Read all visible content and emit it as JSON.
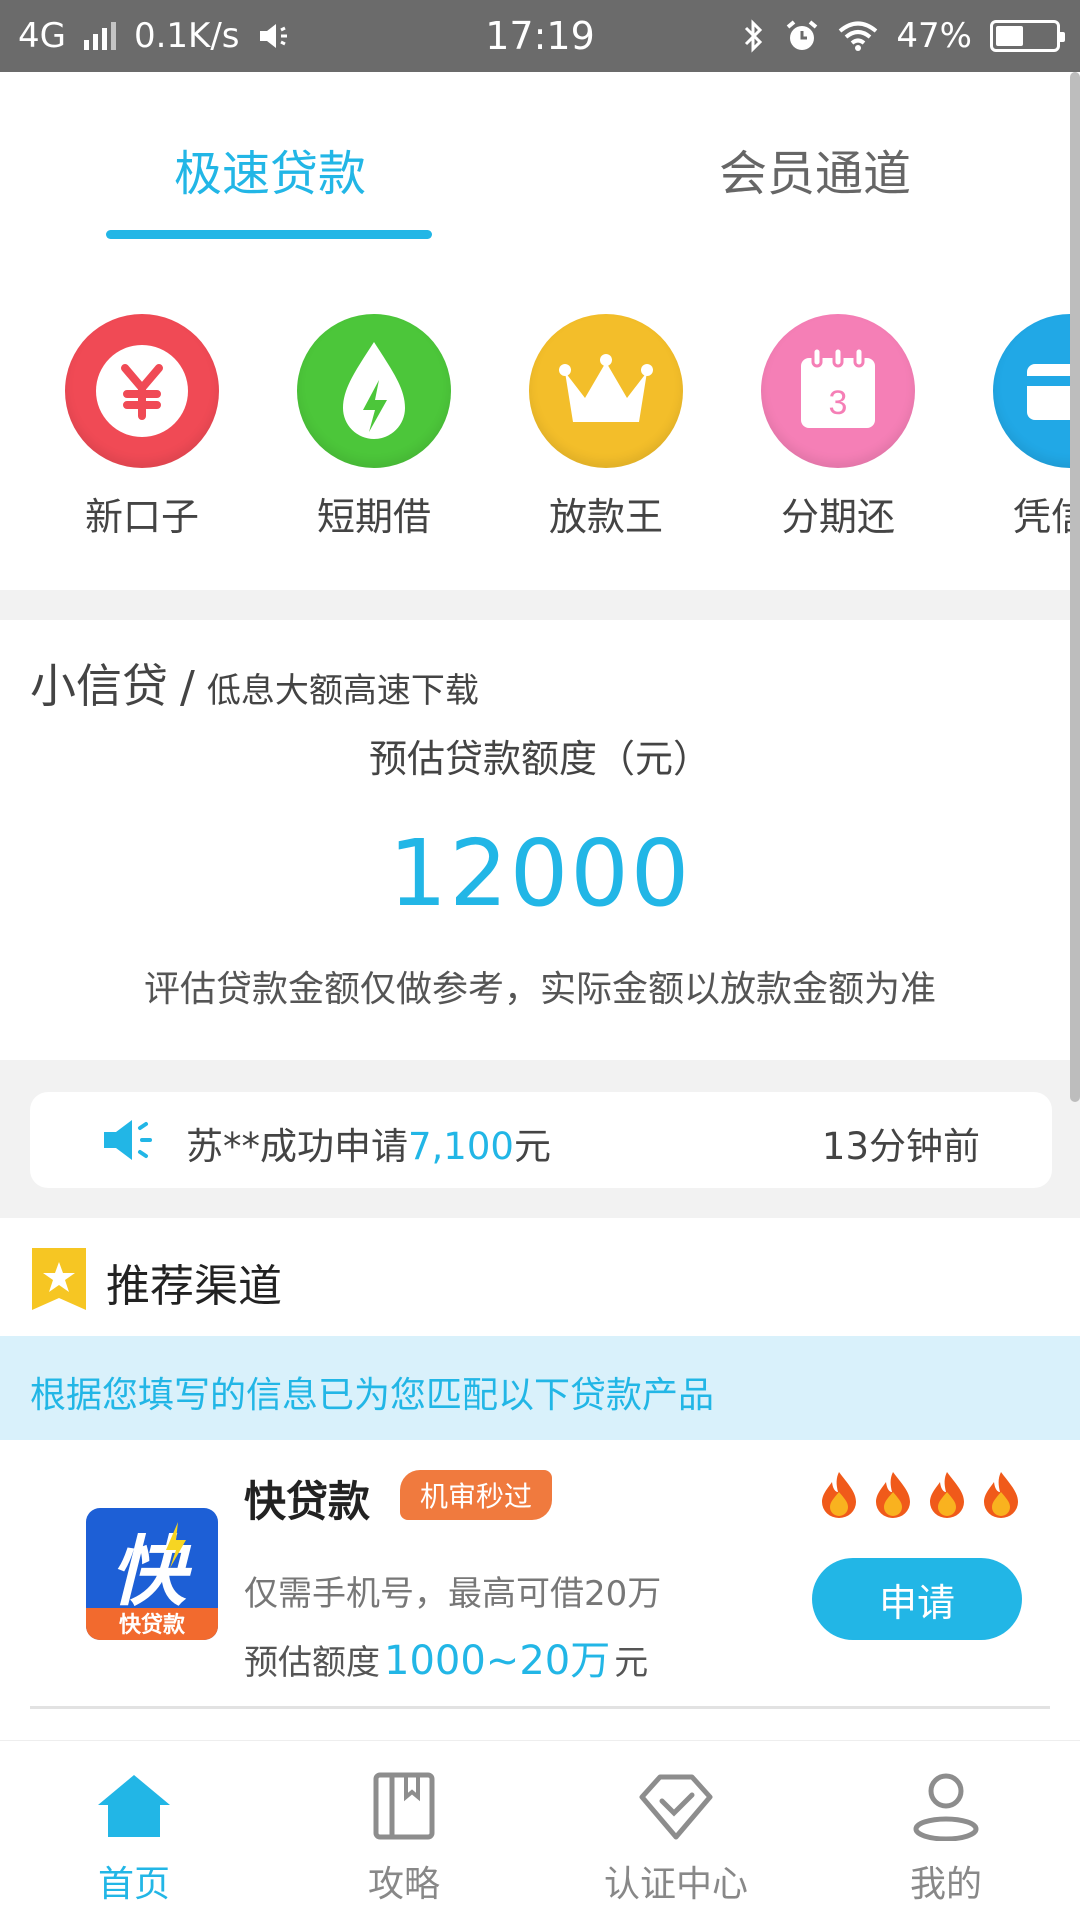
{
  "status_bar": {
    "network": "4G",
    "speed": "0.1K/s",
    "time": "17:19",
    "battery": "47%",
    "battery_level": 0.47
  },
  "tabs": [
    {
      "label": "极速贷款",
      "active": true
    },
    {
      "label": "会员通道",
      "active": false
    }
  ],
  "categories": [
    {
      "label": "新口子",
      "icon": "yuan-coin-icon",
      "color": "#f04a55"
    },
    {
      "label": "短期借",
      "icon": "lightning-drop-icon",
      "color": "#4cc63a"
    },
    {
      "label": "放款王",
      "icon": "crown-icon",
      "color": "#f3be2a"
    },
    {
      "label": "分期还",
      "icon": "calendar-icon",
      "color": "#f57fb6",
      "calendar_day": "3"
    },
    {
      "label": "凭信用",
      "icon": "card-icon",
      "color": "#21a8e6"
    }
  ],
  "estimate": {
    "brand": "小信贷",
    "slash": "/",
    "tagline": "低息大额高速下载",
    "amount_label": "预估贷款额度（元）",
    "amount": "12000",
    "note": "评估贷款金额仅做参考，实际金额以放款金额为准"
  },
  "notice": {
    "prefix": "苏**成功申请",
    "amount": "7,100",
    "suffix": "元",
    "time": "13分钟前"
  },
  "recommend": {
    "title": "推荐渠道",
    "match_text": "根据您填写的信息已为您匹配以下贷款产品"
  },
  "product": {
    "name": "快贷款",
    "badge": "机审秒过",
    "desc": "仅需手机号，最高可借20万",
    "range_prefix": "预估额度",
    "range": "1000~20万",
    "range_suffix": "元",
    "apply_label": "申请",
    "flame_count": 4,
    "logo_char": "快",
    "logo_sub": "快贷款"
  },
  "bottom_nav": [
    {
      "label": "首页",
      "icon": "home-icon",
      "active": true
    },
    {
      "label": "攻略",
      "icon": "book-icon",
      "active": false
    },
    {
      "label": "认证中心",
      "icon": "shield-check-icon",
      "active": false
    },
    {
      "label": "我的",
      "icon": "user-icon",
      "active": false
    }
  ],
  "colors": {
    "accent": "#22b6e6",
    "badge": "#f07a3e"
  }
}
